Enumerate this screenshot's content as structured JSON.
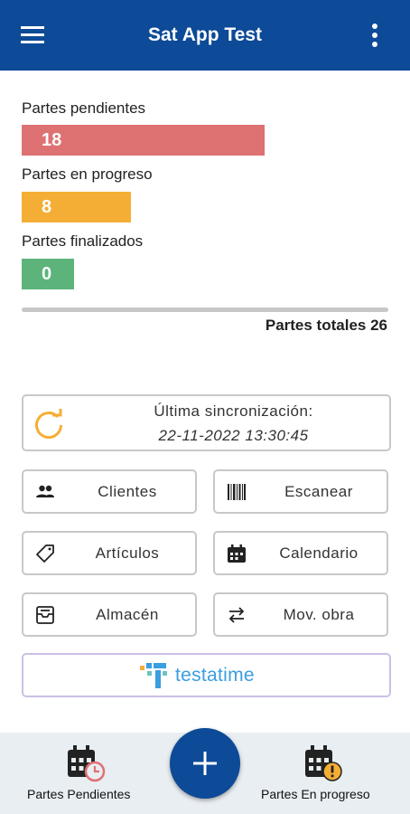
{
  "app": {
    "title": "Sat App Test"
  },
  "header": {
    "menu_icon": "hamburger-menu-icon",
    "more_icon": "more-vert-icon"
  },
  "stats": [
    {
      "label": "Partes pendientes",
      "value": "18",
      "fraction": 0.69,
      "color": "#de7172"
    },
    {
      "label": "Partes en progreso",
      "value": "8",
      "fraction": 0.31,
      "color": "#f5ae35"
    },
    {
      "label": "Partes finalizados",
      "value": "0",
      "fraction": 0.0,
      "color": "#5cb47b"
    }
  ],
  "totals": {
    "text": "Partes totales 26"
  },
  "sync": {
    "title": "Última sincronización:",
    "datetime": "22-11-2022 13:30:45",
    "icon": "refresh-icon",
    "icon_color": "#f5ae35"
  },
  "actions": [
    {
      "label": "Clientes",
      "icon": "people-icon"
    },
    {
      "label": "Escanear",
      "icon": "barcode-icon"
    },
    {
      "label": "Artículos",
      "icon": "tag-icon"
    },
    {
      "label": "Calendario",
      "icon": "calendar-icon"
    },
    {
      "label": "Almacén",
      "icon": "inbox-icon"
    },
    {
      "label": "Mov. obra",
      "icon": "swap-arrows-icon"
    }
  ],
  "brand": {
    "text": "testatime",
    "logo_icon": "testatime-logo-icon",
    "color": "#3a9ee0"
  },
  "bottom_nav": {
    "left": {
      "label": "Partes Pendientes",
      "icon": "calendar-clock-icon",
      "badge_color": "#de7172"
    },
    "fab": {
      "icon": "plus-icon"
    },
    "right": {
      "label": "Partes En progreso",
      "icon": "calendar-alert-icon",
      "badge_color": "#f5ae35"
    }
  },
  "colors": {
    "primary": "#0d4a97",
    "nav_background": "#e9eef2"
  }
}
